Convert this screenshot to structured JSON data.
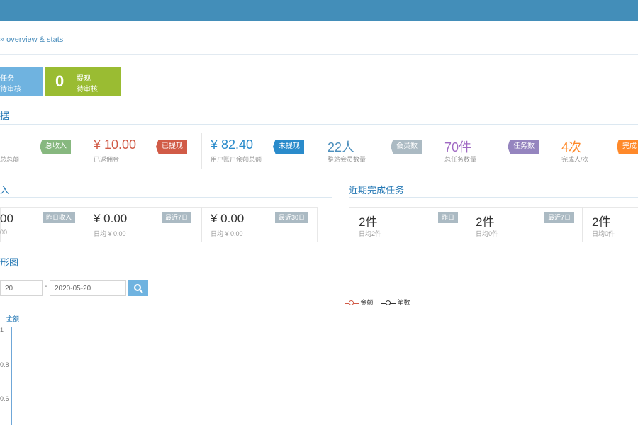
{
  "breadcrumb": "» overview & stats",
  "tiles": [
    {
      "value": "",
      "line1": "任务",
      "line2": "待审核"
    },
    {
      "value": "0",
      "line1": "提现",
      "line2": "待审核"
    }
  ],
  "section1": {
    "title": "据"
  },
  "stats": [
    {
      "value": "",
      "sub": "总总额",
      "ribbon": "总收入",
      "color": "#87b87f"
    },
    {
      "value": "¥ 10.00",
      "sub": "已返佣金",
      "ribbon": "已提现",
      "color": "#d15b47"
    },
    {
      "value": "¥ 82.40",
      "sub": "用户账户余额总额",
      "ribbon": "未提现",
      "color": "#2a8bcb"
    },
    {
      "value": "22人",
      "sub": "整站会员数量",
      "ribbon": "会员数",
      "color": "#abbac3"
    },
    {
      "value": "70件",
      "sub": "总任务数量",
      "ribbon": "任务数",
      "color": "#9585bf"
    },
    {
      "value": "4次",
      "sub": "完成人/次",
      "ribbon": "完成",
      "color": "#ff892a"
    }
  ],
  "income": {
    "title": "入",
    "cells": [
      {
        "value": "00",
        "sub": "00",
        "tag": "昨日收入"
      },
      {
        "value": "¥ 0.00",
        "sub": "日均 ¥ 0.00",
        "tag": "最近7日"
      },
      {
        "value": "¥ 0.00",
        "sub": "日均 ¥ 0.00",
        "tag": "最近30日"
      }
    ]
  },
  "tasks": {
    "title": "近期完成任务",
    "cells": [
      {
        "value": "2件",
        "sub": "日均2件",
        "tag": "昨日"
      },
      {
        "value": "2件",
        "sub": "日均0件",
        "tag": "最近7日"
      },
      {
        "value": "2件",
        "sub": "日均0件",
        "tag": ""
      }
    ]
  },
  "chart_section": {
    "title": "形图"
  },
  "filter": {
    "date_from": "20",
    "date_to": "2020-05-20",
    "separator": "-"
  },
  "chart_data": {
    "type": "line",
    "ylabel": "金额",
    "yticks": [
      "1",
      "0.8",
      "0.6"
    ],
    "series": [
      {
        "name": "金额",
        "color": "#d15b47"
      },
      {
        "name": "笔数",
        "color": "#333333"
      }
    ],
    "ylim": [
      0.6,
      1
    ]
  }
}
